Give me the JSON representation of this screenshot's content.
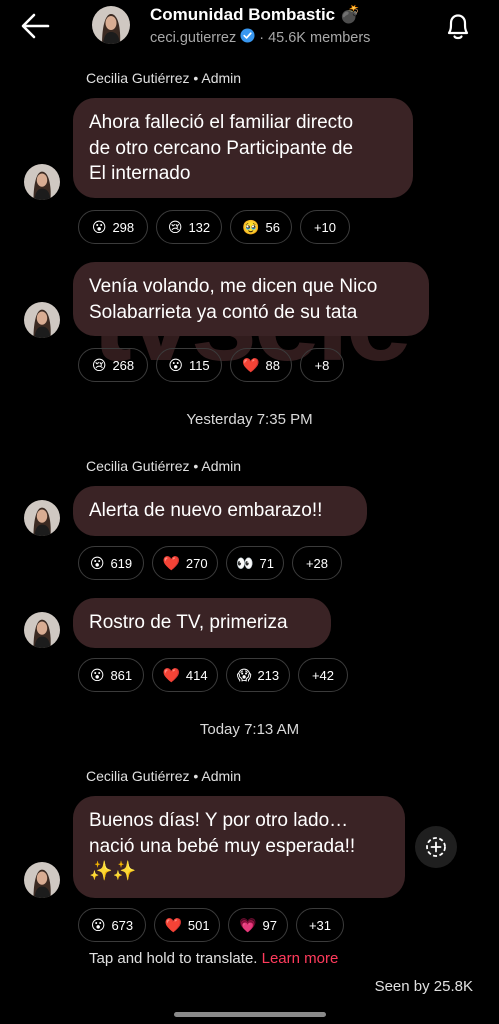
{
  "header": {
    "title": "Comunidad Bombastic",
    "title_emoji": "💣",
    "username": "ceci.gutierrez",
    "separator": "·",
    "members": "45.6K members"
  },
  "watermark_text": "TVSELE",
  "messages": [
    {
      "sender": "Cecilia Gutiérrez • Admin",
      "text": "Ahora falleció el familiar directo\nde otro cercano Participante de\nEl internado",
      "reactions": [
        {
          "emoji": "😮",
          "count": "298"
        },
        {
          "emoji": "😢",
          "count": "132"
        },
        {
          "emoji": "🥹",
          "count": "56"
        },
        {
          "emoji": "",
          "count": "+10"
        }
      ]
    },
    {
      "sender": "",
      "text": "Venía volando, me dicen que Nico\nSolabarrieta ya contó de su tata",
      "reactions": [
        {
          "emoji": "😢",
          "count": "268"
        },
        {
          "emoji": "😮",
          "count": "115"
        },
        {
          "emoji": "❤️",
          "count": "88"
        },
        {
          "emoji": "",
          "count": "+8"
        }
      ]
    },
    {
      "timestamp": "Yesterday 7:35 PM",
      "sender": "Cecilia Gutiérrez • Admin",
      "text": "Alerta de nuevo embarazo!!",
      "reactions": [
        {
          "emoji": "😮",
          "count": "619"
        },
        {
          "emoji": "❤️",
          "count": "270"
        },
        {
          "emoji": "👀",
          "count": "71"
        },
        {
          "emoji": "",
          "count": "+28"
        }
      ]
    },
    {
      "sender": "",
      "text": "Rostro de TV, primeriza",
      "reactions": [
        {
          "emoji": "😮",
          "count": "861"
        },
        {
          "emoji": "❤️",
          "count": "414"
        },
        {
          "emoji": "😱",
          "count": "213"
        },
        {
          "emoji": "",
          "count": "+42"
        }
      ]
    },
    {
      "timestamp": "Today 7:13 AM",
      "sender": "Cecilia Gutiérrez • Admin",
      "text": "Buenos días! Y por otro lado…\nnació una bebé muy esperada!!\n✨✨",
      "reactions": [
        {
          "emoji": "😮",
          "count": "673"
        },
        {
          "emoji": "❤️",
          "count": "501"
        },
        {
          "emoji": "💗",
          "count": "97"
        },
        {
          "emoji": "",
          "count": "+31"
        }
      ]
    }
  ],
  "footer": {
    "translate_hint": "Tap and hold to translate.",
    "learn_more": "Learn more",
    "seen": "Seen by 25.8K"
  },
  "colors": {
    "bubble": "#3a2325",
    "link": "#ff3b5c",
    "verified": "#3897f0"
  }
}
